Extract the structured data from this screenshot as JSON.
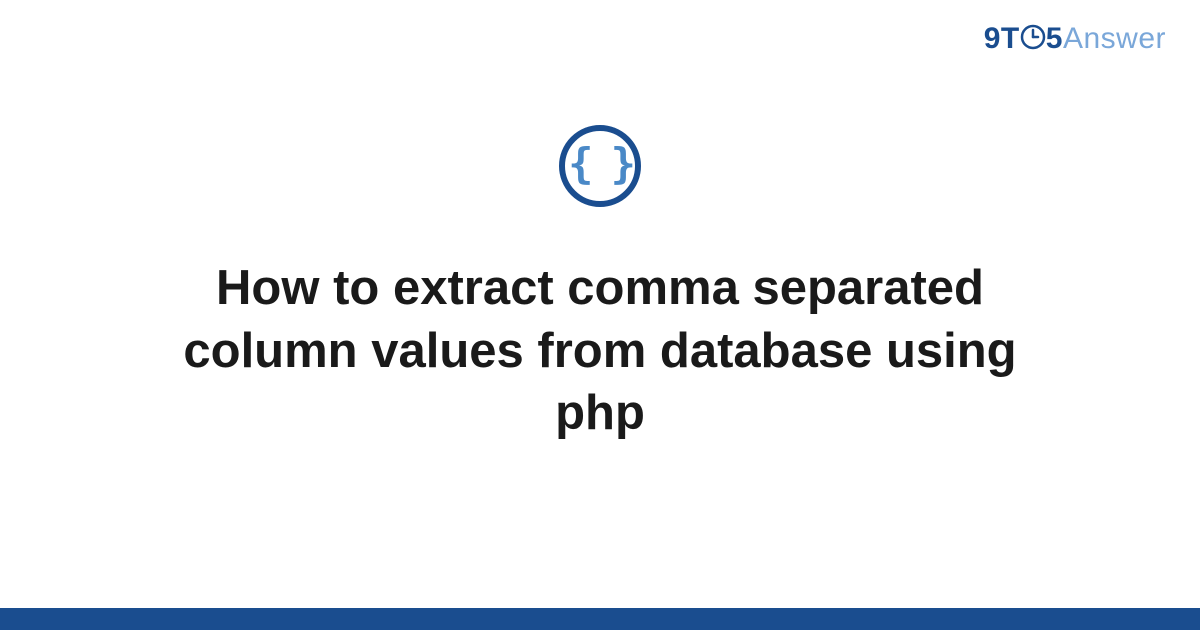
{
  "logo": {
    "prefix": "9T",
    "middle": "5",
    "suffix": "Answer"
  },
  "icon": {
    "braces": "{ }"
  },
  "main": {
    "title": "How to extract comma separated column values from database using php"
  },
  "colors": {
    "primary": "#1a4d8f",
    "accent": "#4a89c7",
    "light": "#7aa7d9"
  }
}
